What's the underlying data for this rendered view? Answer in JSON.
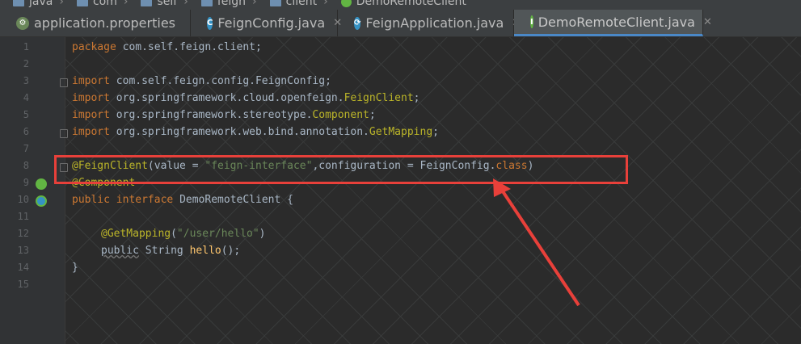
{
  "breadcrumbs": [
    "java",
    "com",
    "self",
    "feign",
    "client",
    "DemoRemoteClient"
  ],
  "tabs": [
    {
      "label": "application.properties",
      "icon": "properties-file-icon",
      "active": false,
      "closable": false
    },
    {
      "label": "FeignConfig.java",
      "icon": "class-icon",
      "active": false,
      "closable": true
    },
    {
      "label": "FeignApplication.java",
      "icon": "spring-boot-app-icon",
      "active": false,
      "closable": true
    },
    {
      "label": "DemoRemoteClient.java",
      "icon": "interface-icon",
      "active": true,
      "closable": true
    }
  ],
  "editor": {
    "line_numbers": [
      "1",
      "2",
      "3",
      "4",
      "5",
      "6",
      "7",
      "8",
      "9",
      "10",
      "11",
      "12",
      "13",
      "14",
      "15"
    ],
    "lines": {
      "l1_pkg": "package",
      "l1_rest": " com.self.feign.client;",
      "imp": "import",
      "l3_rest": " com.self.feign.config.FeignConfig;",
      "l4_a": " org.springframework.cloud.openfeign.",
      "l4_b": "FeignClient",
      "l4_c": ";",
      "l5_a": " org.springframework.stereotype.",
      "l5_b": "Component",
      "l5_c": ";",
      "l6_a": " org.springframework.web.bind.annotation.",
      "l6_b": "GetMapping",
      "l6_c": ";",
      "l8_ann": "@FeignClient",
      "l8_a": "(value = ",
      "l8_str": "\"feign-interface\"",
      "l8_b": ",configuration = FeignConfig.",
      "l8_cls": "class",
      "l8_c": ")",
      "l9_ann": "@Component",
      "l10_pub": "public",
      "l10_intf": " interface",
      "l10_rest": " DemoRemoteClient {",
      "l12_ann": "@GetMapping",
      "l12_a": "(",
      "l12_str": "\"/user/hello\"",
      "l12_b": ")",
      "l13_pub": "public",
      "l13_a": " String ",
      "l13_fn": "hello",
      "l13_b": "();",
      "l14": "}"
    }
  },
  "colors": {
    "keyword": "#cc7832",
    "annotation": "#bbb529",
    "string": "#6a8759",
    "method": "#ffc66d",
    "highlight": "#e8403a"
  }
}
